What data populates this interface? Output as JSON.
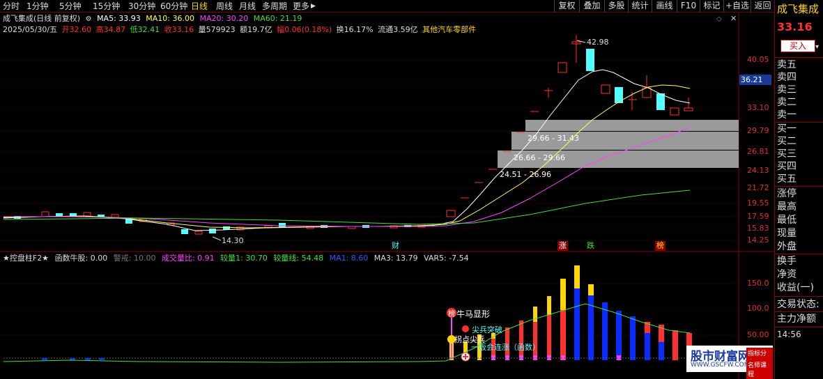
{
  "toolbar": {
    "tabs": [
      {
        "label": "分时"
      },
      {
        "label": "1分钟"
      },
      {
        "label": "5分钟"
      },
      {
        "label": "15分钟"
      },
      {
        "label": "30分钟"
      },
      {
        "label": "60分钟"
      },
      {
        "label": "日线"
      },
      {
        "label": "周线"
      },
      {
        "label": "月线"
      },
      {
        "label": "多周期"
      },
      {
        "label": "更多"
      }
    ],
    "more_arrow": "▶",
    "right_buttons": [
      "复权",
      "叠加",
      "多股",
      "统计",
      "画线",
      "F10",
      "标记",
      "+自选",
      "返回"
    ]
  },
  "legend": {
    "title": "成飞集成(日线 前复权)",
    "ma5": "MA5: 33.93",
    "ma10": "MA10: 36.00",
    "ma20": "MA20: 30.20",
    "ma60": "MA60: 21.19"
  },
  "info": {
    "date": "2025/05/30/五",
    "open": "开32.60",
    "high": "高34.87",
    "low": "低32.41",
    "close": "收33.16",
    "volume": "量579923",
    "amount": "额19.7亿",
    "change": "幅0.06(0.18%)",
    "turnover": "换16.17%",
    "float": "流通3.59亿",
    "industry": "其他汽车零部件"
  },
  "price_axis": [
    "40.05",
    "36.21",
    "33.10",
    "29.79",
    "26.81",
    "24.13",
    "21.72",
    "19.55",
    "17.59",
    "15.83",
    "14.25"
  ],
  "current_price_label": "36.21",
  "annotations": {
    "high": "42.98",
    "low": "14.30",
    "zone1": "29.66 - 31.43",
    "zone2": "26.66 - 29.66",
    "zone3": "24.51 - 26.96"
  },
  "event_marks": [
    "财",
    "涨",
    "跌",
    "榜"
  ],
  "indicator": {
    "name": "★控盘柱F2★",
    "fn_label": "函数牛股: 0.00",
    "warn": "警戒: 10.00",
    "ratio": "成交量比: 0.91",
    "vol1": "较量1: 30.70",
    "volline": "较量线: 54.48",
    "ma1": "MA1: 8.60",
    "ma3": "MA3: 13.79",
    "var5": "VAR5: -7.54",
    "axis": [
      "150.0",
      "100.0",
      "50.00"
    ],
    "signals": {
      "bang": "榜",
      "bull": "牛马显形",
      "spike_break": "尖兵突破",
      "spike": "拐点尖兵",
      "limit_up": "一板会连涨（函数）"
    }
  },
  "sidebar": {
    "stock_name": "成飞集成",
    "price": "33.16",
    "buy_button": "买入",
    "sell_levels": [
      "卖五",
      "卖四",
      "卖三",
      "卖二",
      "卖一"
    ],
    "buy_levels": [
      "买一",
      "买二",
      "买三",
      "买四",
      "买五"
    ],
    "stats": [
      "涨停",
      "最高",
      "最低",
      "现量",
      "外盘"
    ],
    "stats2": [
      "换手",
      "净资",
      "收益(一)"
    ],
    "status": "交易状态:",
    "main_net": "主力净额",
    "time": "14:56"
  },
  "watermark": {
    "main": "股市财富网",
    "url": "WWW.GSCFW.COM",
    "tag1": "指标分享",
    "tag2": "名师课程"
  },
  "colors": {
    "up": "#ff3030",
    "down": "#54ffff",
    "ma5": "#ffffff",
    "ma10": "#ffff60",
    "ma20": "#ff40ff",
    "ma60": "#40e040",
    "accent": "#ffd700"
  }
}
